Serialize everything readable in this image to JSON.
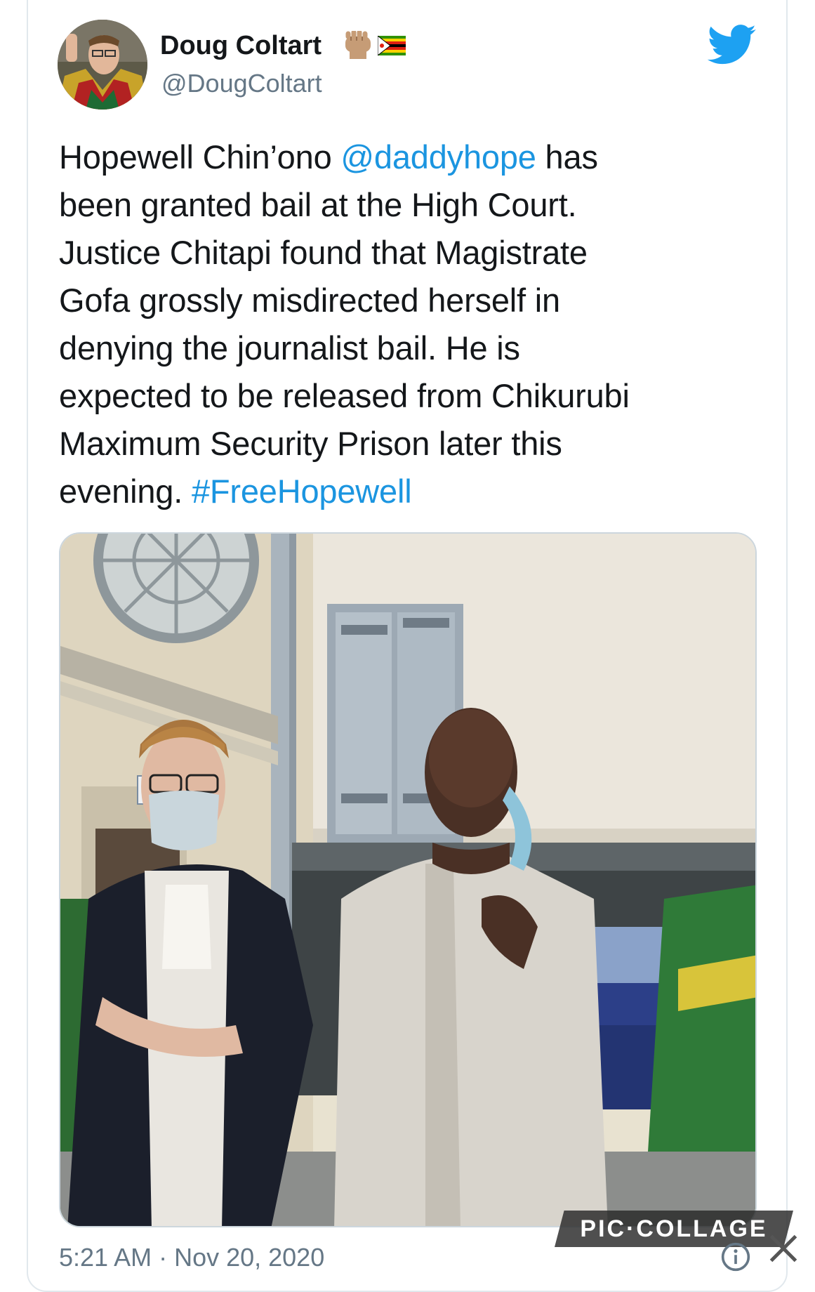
{
  "tweet": {
    "display_name": "Doug Coltart",
    "emojis": [
      "raised-fist-emoji",
      "zimbabwe-flag-emoji"
    ],
    "handle": "@DougColtart",
    "text_lines": [
      {
        "before": "Hopewell Chin’ono ",
        "link": "@daddyhope",
        "after": " has"
      },
      {
        "before": "been granted bail at the High Court.",
        "link": "",
        "after": ""
      },
      {
        "before": "Justice Chitapi found that Magistrate",
        "link": "",
        "after": ""
      },
      {
        "before": "Gofa grossly misdirected herself in",
        "link": "",
        "after": ""
      },
      {
        "before": "denying the journalist bail. He is",
        "link": "",
        "after": ""
      },
      {
        "before": "expected to be released from Chikurubi",
        "link": "",
        "after": ""
      },
      {
        "before": "Maximum Security Prison later this",
        "link": "",
        "after": ""
      },
      {
        "before": "evening. ",
        "link": "#FreeHopewell",
        "after": ""
      }
    ],
    "timestamp": "5:21 AM · Nov 20, 2020"
  },
  "watermark": "PIC·COLLAGE",
  "icons": {
    "brand": "twitter-bird-icon",
    "info": "info-icon",
    "close": "close-icon"
  },
  "colors": {
    "link": "#1b95e0",
    "twitter_blue": "#1da1f2",
    "secondary_text": "#657786",
    "border": "#e1e8ed"
  }
}
